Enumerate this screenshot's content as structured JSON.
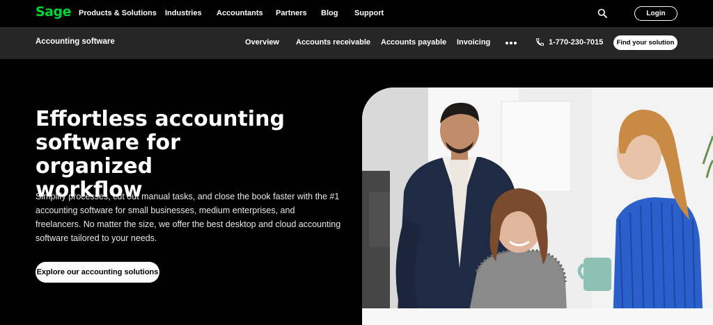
{
  "brand": {
    "logo_text": "Sage",
    "accent": "#00d639"
  },
  "topnav": {
    "items": [
      "Products & Solutions",
      "Industries",
      "Accountants",
      "Partners",
      "Blog",
      "Support"
    ],
    "search_icon": "search-icon",
    "login_label": "Login"
  },
  "subnav": {
    "title": "Accounting software",
    "items": [
      "Overview",
      "Accounts receivable",
      "Accounts payable",
      "Invoicing"
    ],
    "more_icon": "more-dots-icon",
    "phone": "1-770-230-7015",
    "find_label": "Find your solution"
  },
  "hero": {
    "title_lines": [
      "Effortless accounting",
      "software for organized",
      "workflow"
    ],
    "body": "Simplify processes, cut out manual tasks, and close the book faster with the #1 accounting software for small businesses, medium enterprises, and freelancers. No matter the size, we offer the best desktop and cloud accounting software tailored to your needs.",
    "cta_label": "Explore our accounting solutions",
    "image": "photo of three colleagues in an office"
  }
}
